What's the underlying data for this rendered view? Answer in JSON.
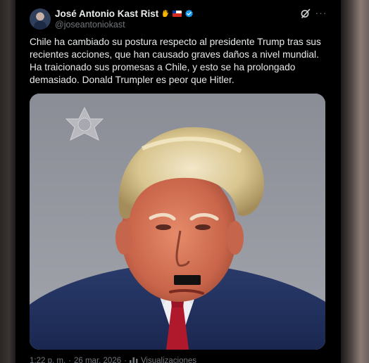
{
  "post": {
    "author": {
      "display_name": "José Antonio Kast Rist",
      "handle": "@joseantoniokast",
      "emoji": "hand-emoji",
      "flag": "chile-flag",
      "verified": true
    },
    "text": "Chile ha cambiado su postura respecto al presidente Trump tras sus recientes acciones, que han causado graves daños a nivel mundial. Ha traicionado sus promesas a Chile, y esto se ha prolongado demasiado. Donald Trumpler es peor que Hitler.",
    "media": {
      "icon": "sheriff-badge-watermark",
      "description_icon": "mugshot-photo"
    },
    "meta": {
      "time": "1:22 p. m.",
      "separator": "·",
      "date": "26 mar. 2026",
      "views_label": "Visualizaciones"
    }
  },
  "colors": {
    "card_bg": "#000000",
    "text_primary": "#e7e9ea",
    "text_secondary": "#71767b",
    "verified_blue": "#1d9bf0"
  }
}
